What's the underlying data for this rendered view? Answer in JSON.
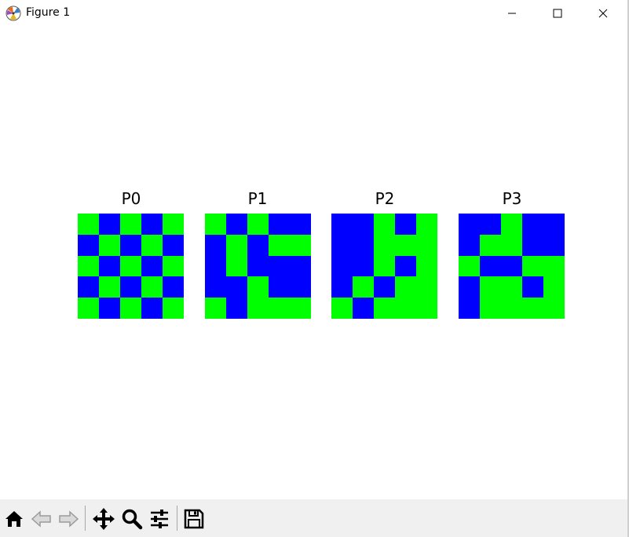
{
  "window": {
    "title": "Figure 1"
  },
  "figure": {
    "color_zero": "#0000ff",
    "color_one": "#00ff00",
    "panels": [
      {
        "title": "P0",
        "grid": [
          [
            1,
            0,
            1,
            0,
            1
          ],
          [
            0,
            1,
            0,
            1,
            0
          ],
          [
            1,
            0,
            1,
            0,
            1
          ],
          [
            0,
            1,
            0,
            1,
            0
          ],
          [
            1,
            0,
            1,
            0,
            1
          ]
        ]
      },
      {
        "title": "P1",
        "grid": [
          [
            1,
            0,
            1,
            0,
            0
          ],
          [
            0,
            1,
            0,
            1,
            1
          ],
          [
            0,
            1,
            0,
            0,
            0
          ],
          [
            0,
            0,
            1,
            0,
            0
          ],
          [
            1,
            0,
            1,
            1,
            1
          ]
        ]
      },
      {
        "title": "P2",
        "grid": [
          [
            0,
            0,
            1,
            0,
            1
          ],
          [
            0,
            0,
            1,
            1,
            1
          ],
          [
            0,
            0,
            1,
            0,
            1
          ],
          [
            0,
            1,
            0,
            1,
            1
          ],
          [
            1,
            0,
            1,
            1,
            1
          ]
        ]
      },
      {
        "title": "P3",
        "grid": [
          [
            0,
            0,
            1,
            0,
            0
          ],
          [
            0,
            1,
            1,
            0,
            0
          ],
          [
            1,
            0,
            0,
            1,
            1
          ],
          [
            0,
            1,
            1,
            0,
            1
          ],
          [
            0,
            1,
            1,
            1,
            1
          ]
        ]
      }
    ]
  },
  "toolbar": {
    "buttons": [
      {
        "name": "home-icon"
      },
      {
        "name": "back-icon"
      },
      {
        "name": "forward-icon"
      },
      {
        "name": "pan-icon"
      },
      {
        "name": "zoom-icon"
      },
      {
        "name": "configure-subplots-icon"
      },
      {
        "name": "save-icon"
      }
    ]
  }
}
